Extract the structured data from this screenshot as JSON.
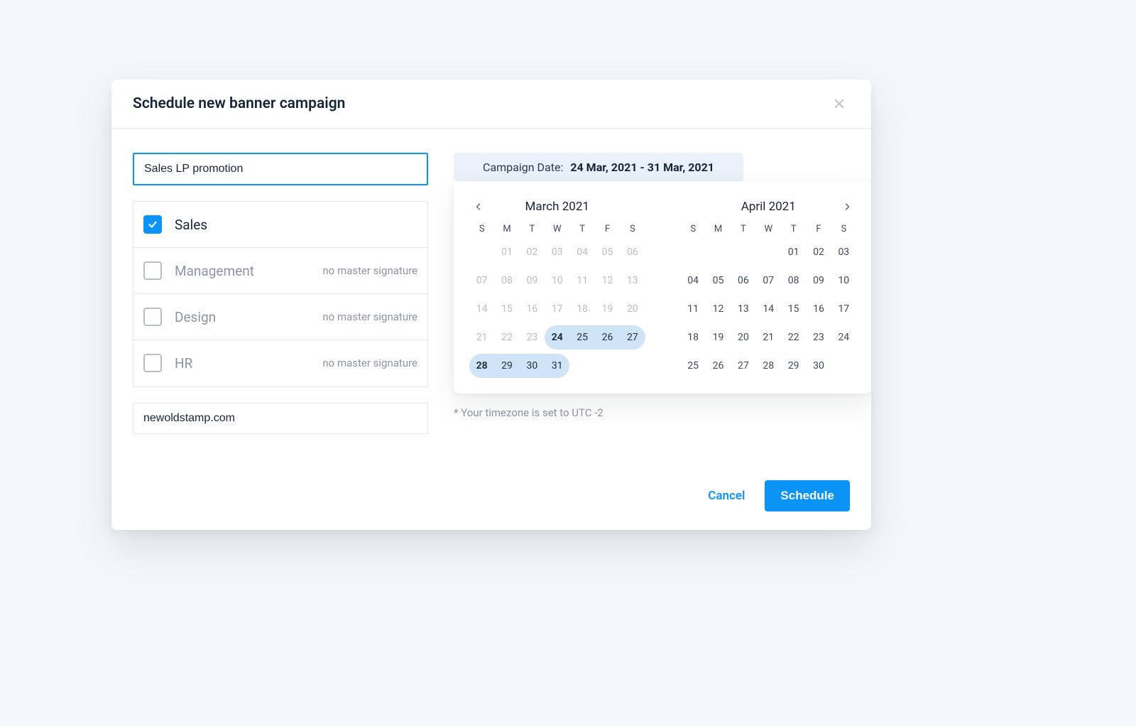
{
  "modal": {
    "title": "Schedule new banner campaign",
    "campaign_name": "Sales LP promotion",
    "url": "newoldstamp.com",
    "timezone_note": "* Your timezone is set to UTC -2",
    "cancel_label": "Cancel",
    "schedule_label": "Schedule"
  },
  "departments": [
    {
      "name": "Sales",
      "checked": true,
      "note": ""
    },
    {
      "name": "Management",
      "checked": false,
      "note": "no master signature"
    },
    {
      "name": "Design",
      "checked": false,
      "note": "no master signature"
    },
    {
      "name": "HR",
      "checked": false,
      "note": "no master signature"
    }
  ],
  "date_range": {
    "label": "Campaign Date:",
    "value": "24 Mar, 2021 - 31 Mar, 2021"
  },
  "dow": [
    "S",
    "M",
    "T",
    "W",
    "T",
    "F",
    "S"
  ],
  "months": [
    {
      "title": "March 2021",
      "prev_nav": true,
      "next_nav": false,
      "lead_blanks": 1,
      "days": [
        {
          "n": "01",
          "m": true
        },
        {
          "n": "02",
          "m": true
        },
        {
          "n": "03",
          "m": true
        },
        {
          "n": "04",
          "m": true
        },
        {
          "n": "05",
          "m": true
        },
        {
          "n": "06",
          "m": true
        },
        {
          "n": "07",
          "m": true
        },
        {
          "n": "08",
          "m": true
        },
        {
          "n": "09",
          "m": true
        },
        {
          "n": "10",
          "m": true
        },
        {
          "n": "11",
          "m": true
        },
        {
          "n": "12",
          "m": true
        },
        {
          "n": "13",
          "m": true
        },
        {
          "n": "14",
          "m": true
        },
        {
          "n": "15",
          "m": true
        },
        {
          "n": "16",
          "m": true
        },
        {
          "n": "17",
          "m": true
        },
        {
          "n": "18",
          "m": true
        },
        {
          "n": "19",
          "m": true
        },
        {
          "n": "20",
          "m": true
        },
        {
          "n": "21",
          "m": true
        },
        {
          "n": "22",
          "m": true
        },
        {
          "n": "23",
          "m": true
        },
        {
          "n": "24",
          "r": "start"
        },
        {
          "n": "25",
          "r": "mid"
        },
        {
          "n": "26",
          "r": "mid"
        },
        {
          "n": "27",
          "r": "end"
        },
        {
          "n": "28",
          "r": "start"
        },
        {
          "n": "29",
          "r": "mid"
        },
        {
          "n": "30",
          "r": "mid"
        },
        {
          "n": "31",
          "r": "end"
        }
      ]
    },
    {
      "title": "April 2021",
      "prev_nav": false,
      "next_nav": true,
      "lead_blanks": 4,
      "days": [
        {
          "n": "01"
        },
        {
          "n": "02"
        },
        {
          "n": "03"
        },
        {
          "n": "04"
        },
        {
          "n": "05"
        },
        {
          "n": "06"
        },
        {
          "n": "07"
        },
        {
          "n": "08"
        },
        {
          "n": "09"
        },
        {
          "n": "10"
        },
        {
          "n": "11"
        },
        {
          "n": "12"
        },
        {
          "n": "13"
        },
        {
          "n": "14"
        },
        {
          "n": "15"
        },
        {
          "n": "16"
        },
        {
          "n": "17"
        },
        {
          "n": "18"
        },
        {
          "n": "19"
        },
        {
          "n": "20"
        },
        {
          "n": "21"
        },
        {
          "n": "22"
        },
        {
          "n": "23"
        },
        {
          "n": "24"
        },
        {
          "n": "25"
        },
        {
          "n": "26"
        },
        {
          "n": "27"
        },
        {
          "n": "28"
        },
        {
          "n": "29"
        },
        {
          "n": "30"
        }
      ]
    }
  ]
}
